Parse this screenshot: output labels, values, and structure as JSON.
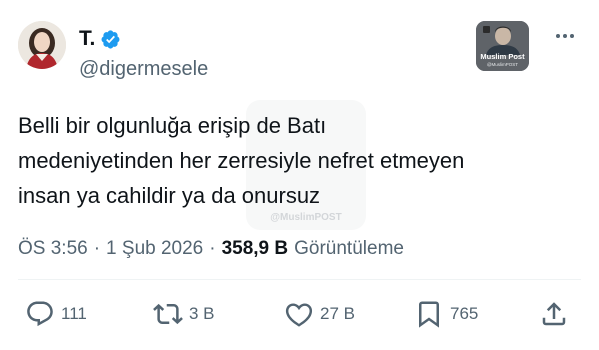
{
  "author": {
    "display_name": "T.",
    "handle": "@digermesele",
    "verified": true,
    "avatar": "portrait-avatar"
  },
  "watermark": {
    "logo_title": "Muslim Post",
    "logo_subtitle": "@MuslimPOST",
    "background_text": "@MuslimPOST"
  },
  "tweet": {
    "lines": [
      "Belli bir olgunluğa erişip de Batı",
      "medeniyetinden her zerresiyle nefret etmeyen",
      "insan ya cahildir ya da onursuz"
    ]
  },
  "meta": {
    "time": "ÖS 3:56",
    "separator": "·",
    "date": "1 Şub 2026",
    "views": "358,9 B",
    "views_label": "Görüntüleme"
  },
  "actions": {
    "replies": "111",
    "reposts": "3 B",
    "likes": "27 B",
    "bookmarks": "765"
  },
  "colors": {
    "text": "#0f1419",
    "secondary": "#536471",
    "verified": "#1d9bf0",
    "divider": "#eff3f4"
  }
}
